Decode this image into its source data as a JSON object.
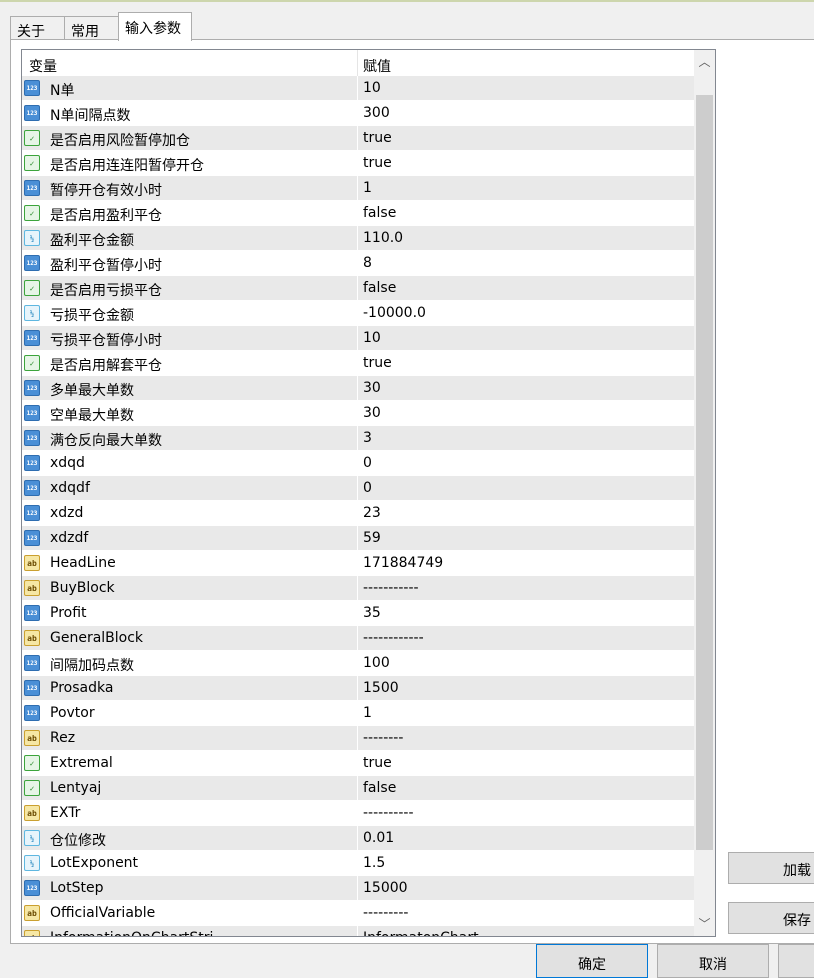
{
  "tabs": [
    {
      "label": "关于"
    },
    {
      "label": "常用"
    },
    {
      "label": "输入参数"
    }
  ],
  "table": {
    "columns": {
      "variable": "变量",
      "value": "赋值"
    },
    "rows": [
      {
        "type": "int",
        "name": "N单",
        "value": "10"
      },
      {
        "type": "int",
        "name": "N单间隔点数",
        "value": "300"
      },
      {
        "type": "bool",
        "name": "是否启用风险暂停加仓",
        "value": "true"
      },
      {
        "type": "bool",
        "name": "是否启用连连阳暂停开仓",
        "value": "true"
      },
      {
        "type": "int",
        "name": "暂停开仓有效小时",
        "value": "1"
      },
      {
        "type": "bool",
        "name": "是否启用盈利平仓",
        "value": "false"
      },
      {
        "type": "double",
        "name": "盈利平仓金额",
        "value": "110.0"
      },
      {
        "type": "int",
        "name": "盈利平仓暂停小时",
        "value": "8"
      },
      {
        "type": "bool",
        "name": "是否启用亏损平仓",
        "value": "false"
      },
      {
        "type": "double",
        "name": "亏损平仓金额",
        "value": "-10000.0"
      },
      {
        "type": "int",
        "name": "亏损平仓暂停小时",
        "value": "10"
      },
      {
        "type": "bool",
        "name": "是否启用解套平仓",
        "value": "true"
      },
      {
        "type": "int",
        "name": "多单最大单数",
        "value": "30"
      },
      {
        "type": "int",
        "name": "空单最大单数",
        "value": "30"
      },
      {
        "type": "int",
        "name": "满仓反向最大单数",
        "value": "3"
      },
      {
        "type": "int",
        "name": "xdqd",
        "value": "0"
      },
      {
        "type": "int",
        "name": "xdqdf",
        "value": "0"
      },
      {
        "type": "int",
        "name": "xdzd",
        "value": "23"
      },
      {
        "type": "int",
        "name": "xdzdf",
        "value": "59"
      },
      {
        "type": "string",
        "name": "HeadLine",
        "value": " 171884749"
      },
      {
        "type": "string",
        "name": "BuyBlock",
        "value": "-----------"
      },
      {
        "type": "int",
        "name": "Profit",
        "value": "35"
      },
      {
        "type": "string",
        "name": "GeneralBlock",
        "value": "------------"
      },
      {
        "type": "int",
        "name": "间隔加码点数",
        "value": "100"
      },
      {
        "type": "int",
        "name": "Prosadka",
        "value": "1500"
      },
      {
        "type": "int",
        "name": "Povtor",
        "value": "1"
      },
      {
        "type": "string",
        "name": "Rez",
        "value": "--------"
      },
      {
        "type": "bool",
        "name": "Extremal",
        "value": "true"
      },
      {
        "type": "bool",
        "name": "Lentyaj",
        "value": "false"
      },
      {
        "type": "string",
        "name": "EXTr",
        "value": "----------"
      },
      {
        "type": "double",
        "name": "仓位修改",
        "value": "0.01"
      },
      {
        "type": "double",
        "name": "LotExponent",
        "value": "1.5"
      },
      {
        "type": "int",
        "name": "LotStep",
        "value": "15000"
      },
      {
        "type": "string",
        "name": "OfficialVariable",
        "value": "---------"
      },
      {
        "type": "string",
        "name": "InformationOnChartStri",
        "value": "InformatonChart"
      }
    ]
  },
  "icons": {
    "int": "123",
    "bool": "✓",
    "double": "½",
    "string": "ab"
  },
  "side_buttons": {
    "load": "加载",
    "save": "保存"
  },
  "buttons": {
    "ok": "确定",
    "cancel": "取消"
  }
}
